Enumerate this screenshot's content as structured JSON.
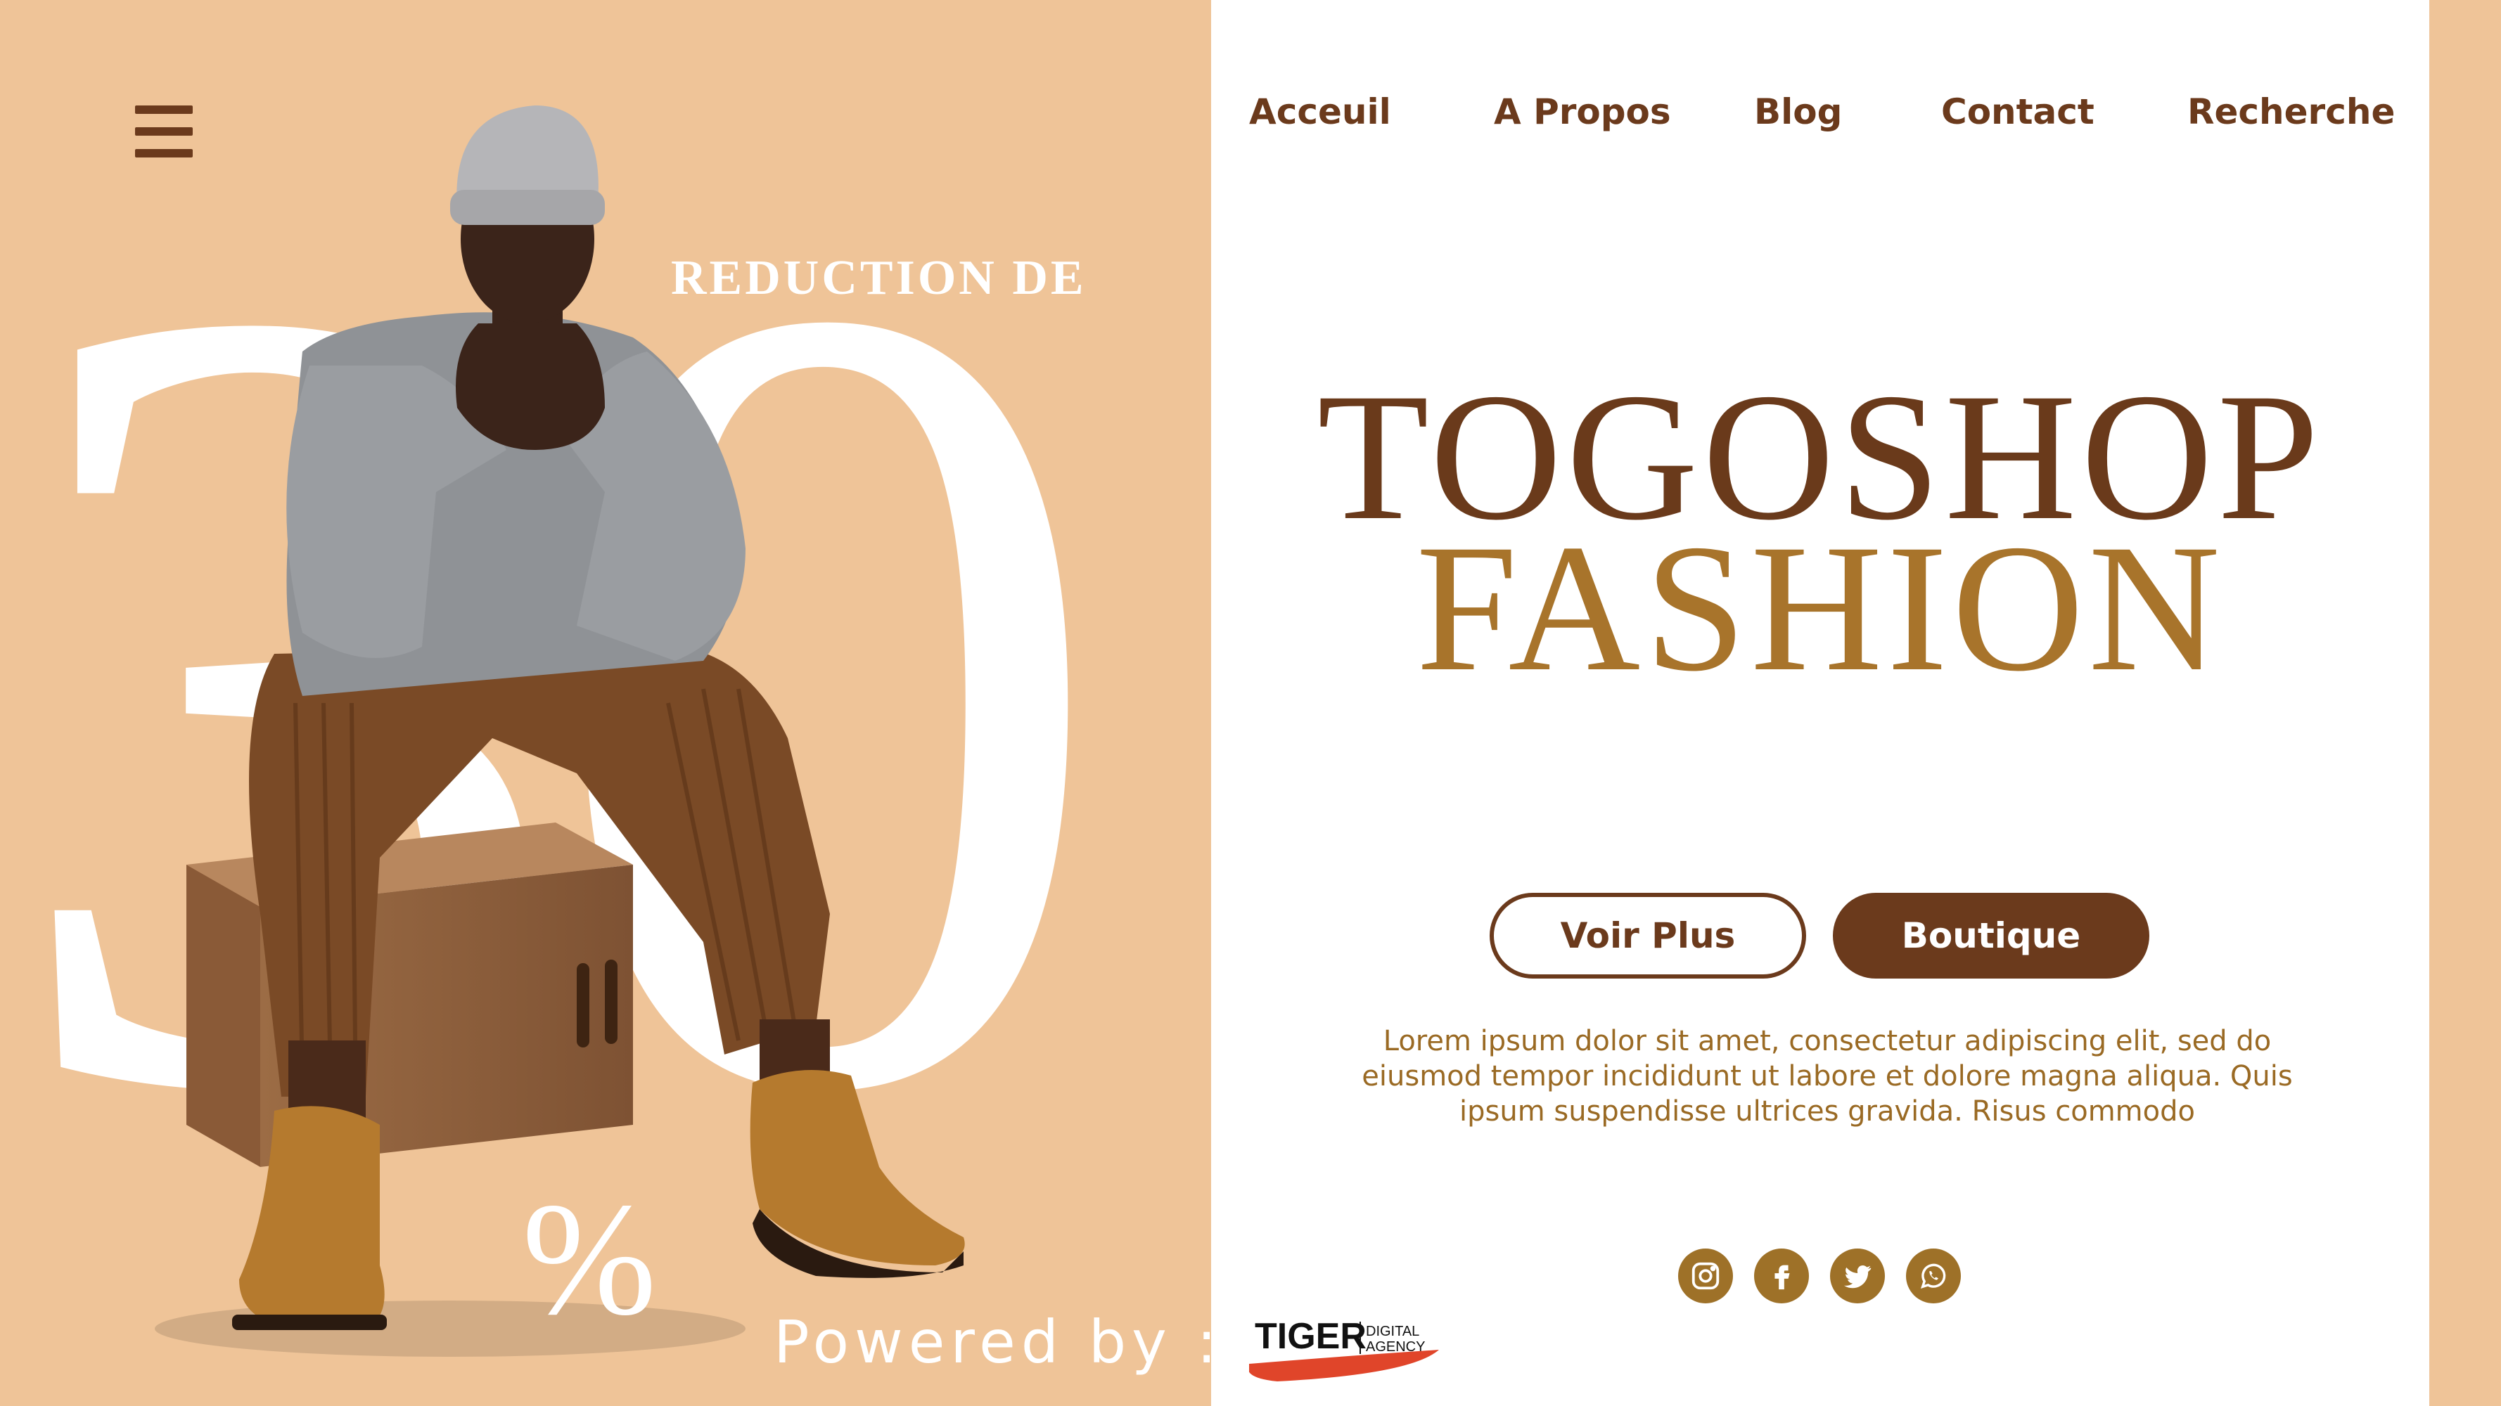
{
  "nav": {
    "items": [
      {
        "label": "Acceuil"
      },
      {
        "label": "A Propos"
      },
      {
        "label": "Blog"
      },
      {
        "label": "Contact"
      },
      {
        "label": "Recherche"
      }
    ]
  },
  "promo": {
    "heading": "REDUCTION DE",
    "number": "30",
    "percent": "%"
  },
  "brand": {
    "line1": "TOGOSHOP",
    "line2": "FASHION"
  },
  "buttons": {
    "more": "Voir Plus",
    "shop": "Boutique"
  },
  "description": "Lorem ipsum dolor sit amet, consectetur adipiscing elit, sed do eiusmod tempor incididunt ut labore et dolore magna aliqua. Quis ipsum suspendisse ultrices gravida. Risus commodo",
  "footer": {
    "powered": "Powered by :",
    "logo_main": "TIGER",
    "logo_sub_1": "DIGITAL",
    "logo_sub_2": "AGENCY"
  },
  "socials": [
    {
      "icon": "instagram-icon"
    },
    {
      "icon": "facebook-icon"
    },
    {
      "icon": "twitter-icon"
    },
    {
      "icon": "whatsapp-icon"
    }
  ],
  "colors": {
    "peach": "#EFC498",
    "brown": "#6B3A1C",
    "gold": "#A8742B"
  }
}
